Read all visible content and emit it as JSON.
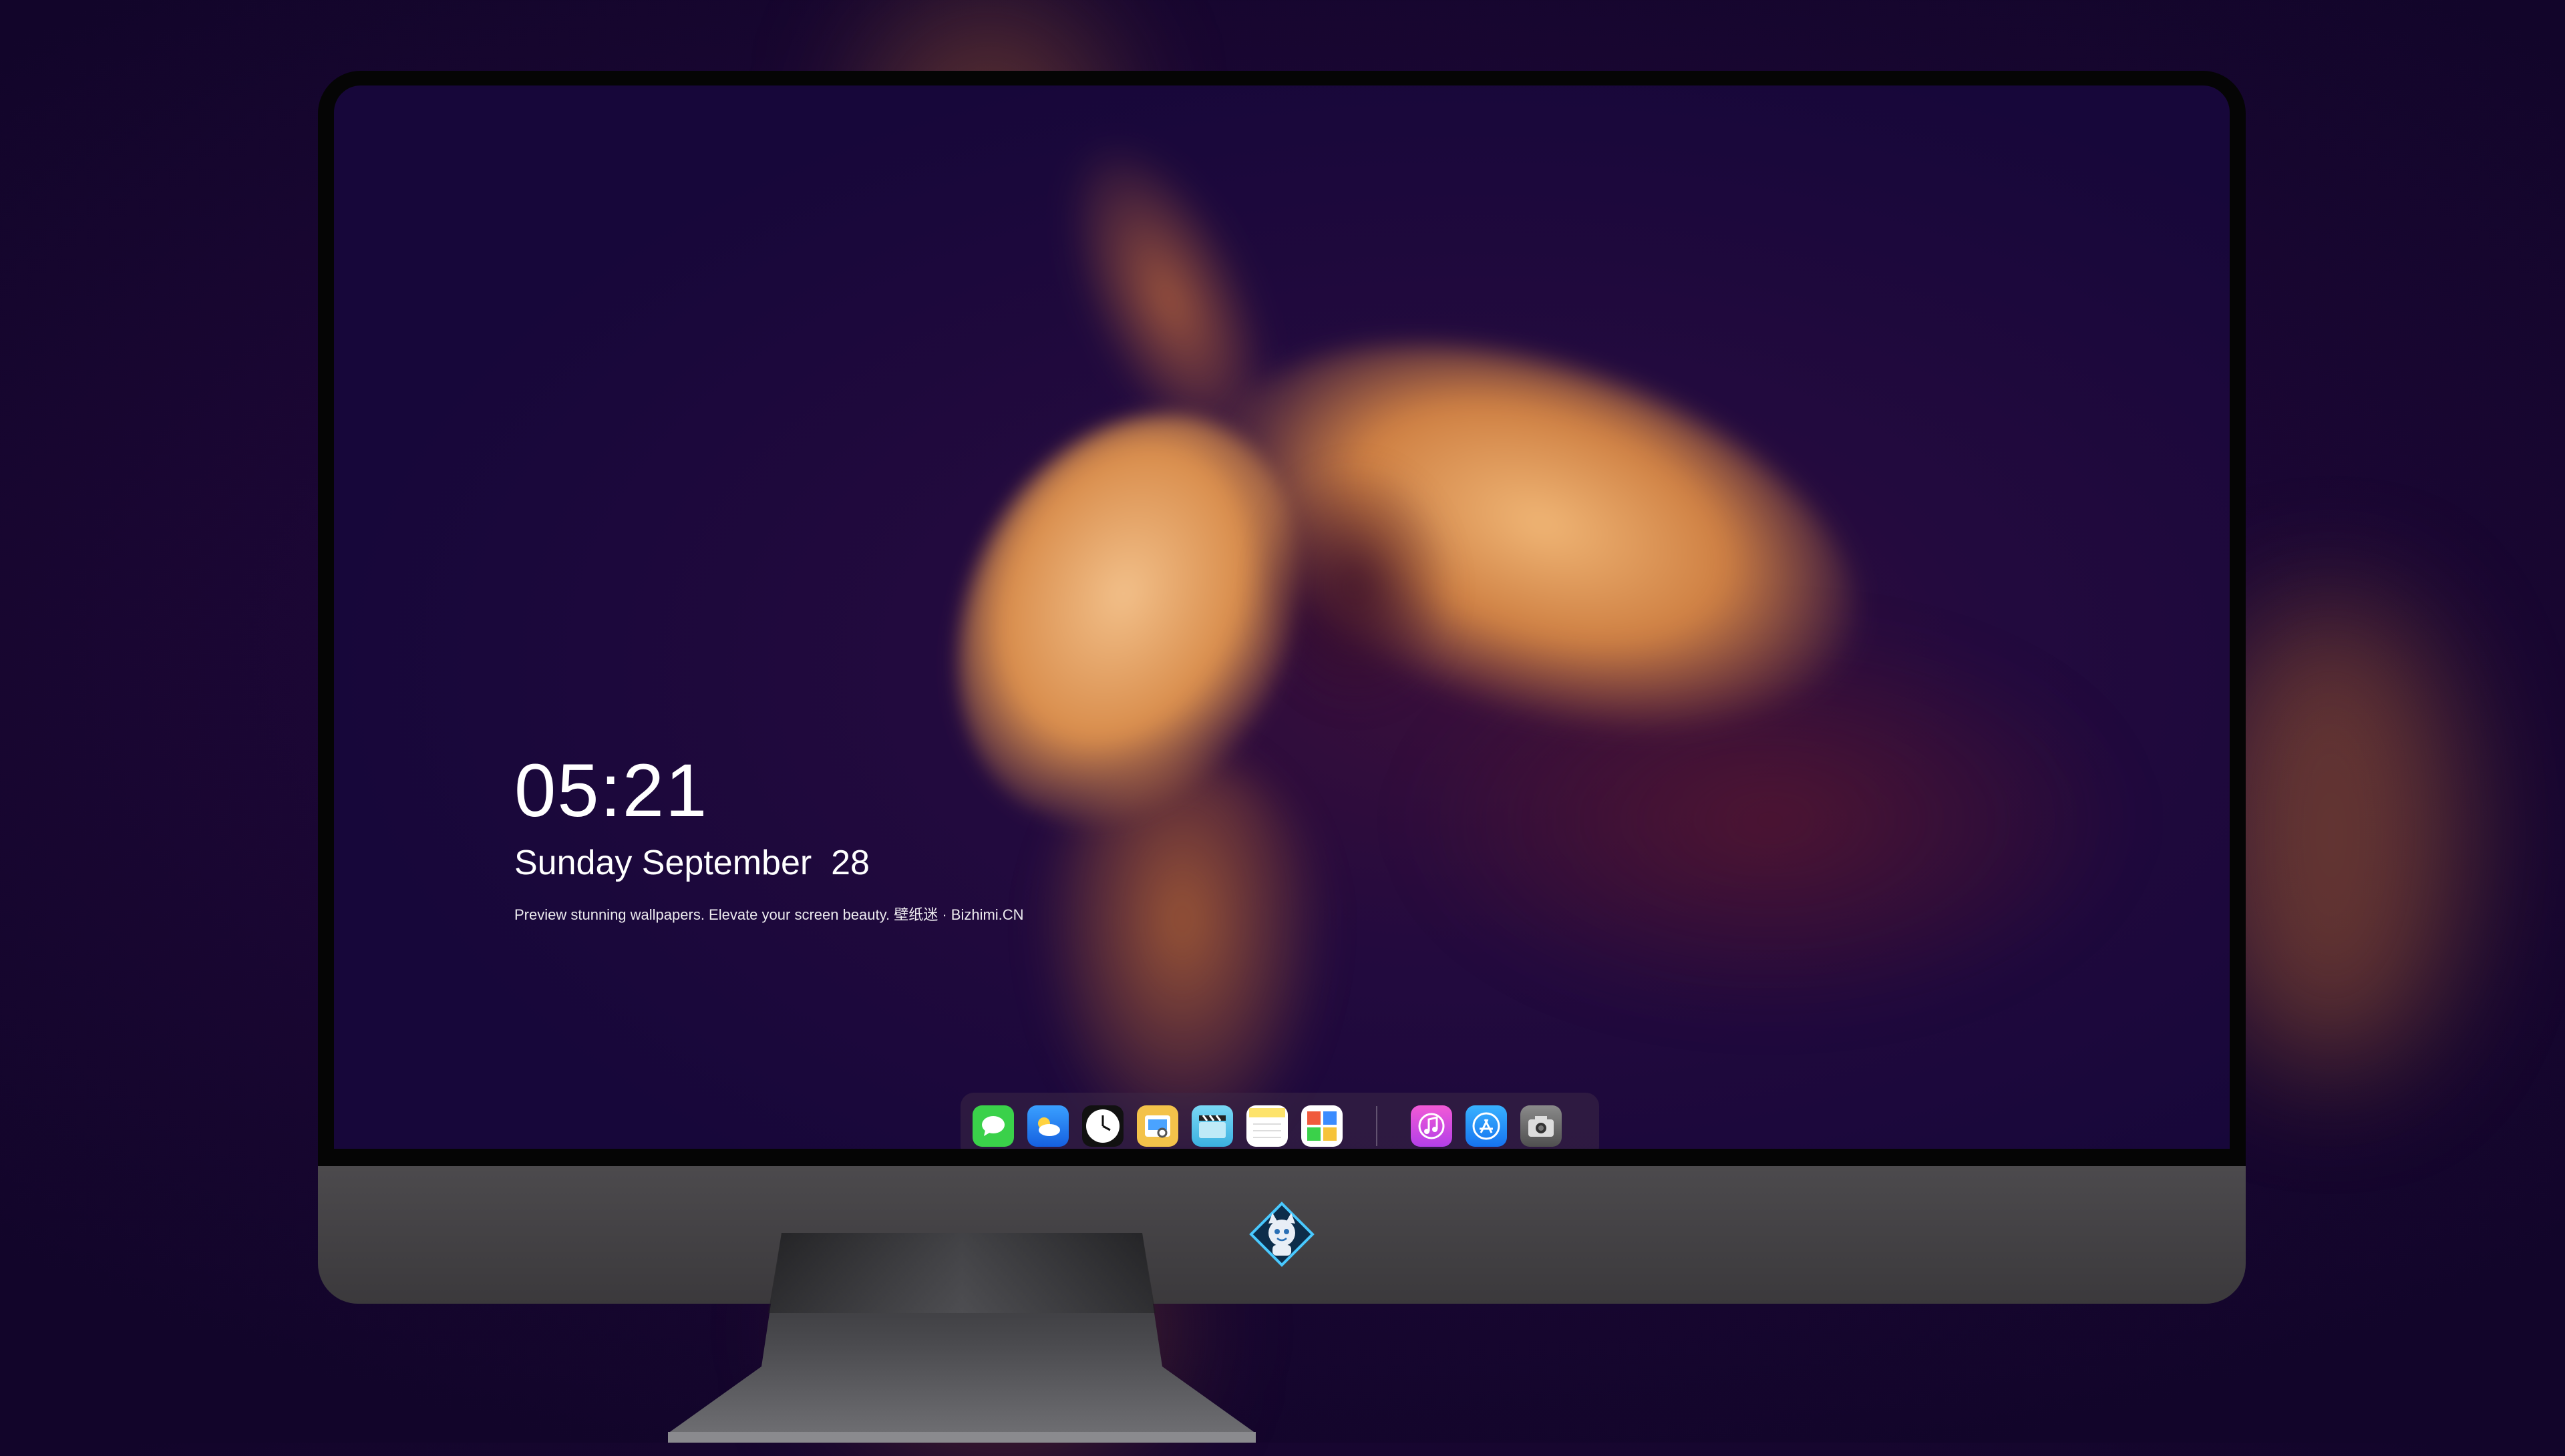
{
  "lockscreen": {
    "time": "05:21",
    "date": "Sunday September  28",
    "tagline": "Preview stunning wallpapers. Elevate your screen beauty. 壁纸迷 · Bizhimi.CN"
  },
  "dock": {
    "apps": [
      {
        "name": "messages-icon",
        "color": "#3ad14a"
      },
      {
        "name": "weather-icon",
        "color": "#2f8bff"
      },
      {
        "name": "clock-icon",
        "color": "#ffffff"
      },
      {
        "name": "preview-icon",
        "color": "#f3c24a"
      },
      {
        "name": "clapper-icon",
        "color": "#59c9ee"
      },
      {
        "name": "notes-icon",
        "color": "#fde36b"
      },
      {
        "name": "photo-grid-icon",
        "color": "#f05a3c"
      },
      {
        "name": "music-icon",
        "color": "#e64fe0"
      },
      {
        "name": "app-store-icon",
        "color": "#2f9bff"
      },
      {
        "name": "camera-icon",
        "color": "#7a7a7a"
      }
    ]
  },
  "monitor": {
    "logo": "mascot-logo-icon",
    "bezel_color": "#050505",
    "chin_color": "#454346"
  }
}
